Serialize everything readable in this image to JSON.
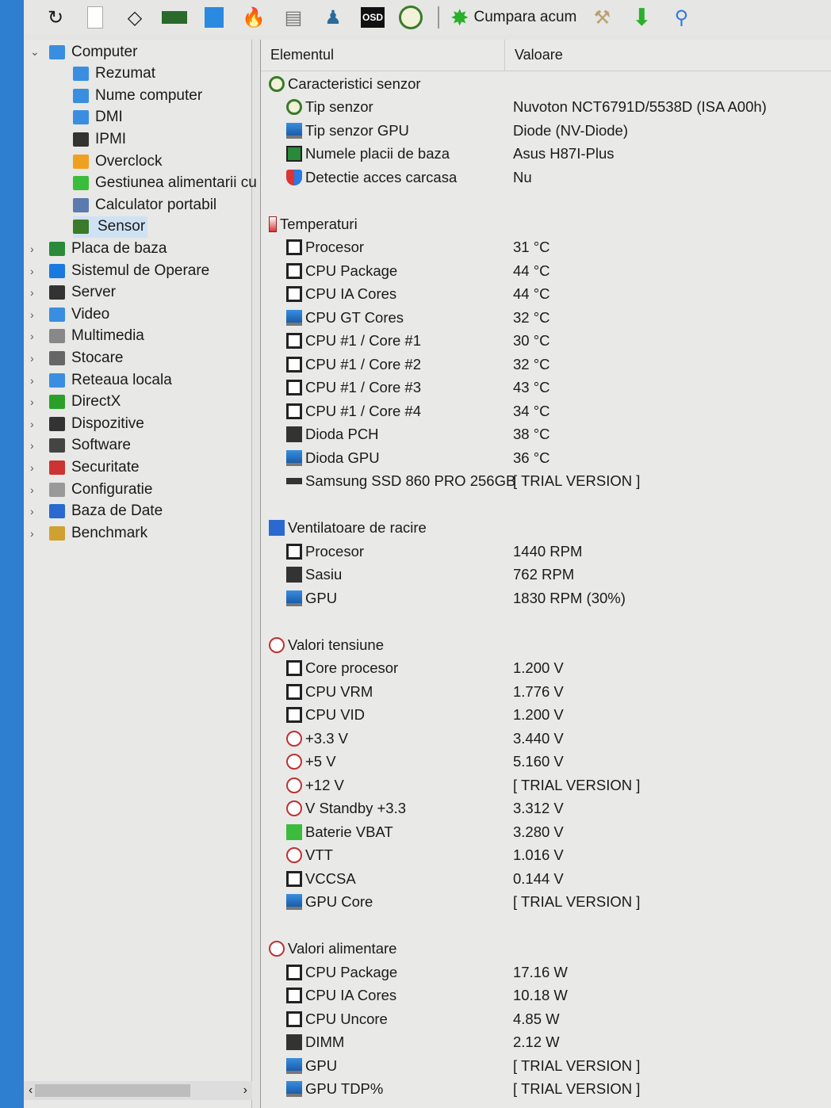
{
  "toolbar": {
    "icons": [
      "refresh-icon",
      "report-icon",
      "cpu-chip-icon",
      "memory-icon",
      "network-icon",
      "flame-icon",
      "benchmark-icon",
      "user-icon",
      "osd-icon",
      "sensor-gauge-icon"
    ],
    "osd_label": "OSD",
    "buy_label": "Cumpara acum",
    "right_icons": [
      "tools-icon",
      "download-icon",
      "search-icon"
    ]
  },
  "tree": {
    "items": [
      {
        "label": "Computer",
        "level": 0,
        "expanded": true,
        "icon": "computer-icon"
      },
      {
        "label": "Rezumat",
        "level": 1,
        "icon": "monitor-icon"
      },
      {
        "label": "Nume computer",
        "level": 1,
        "icon": "monitor-icon"
      },
      {
        "label": "DMI",
        "level": 1,
        "icon": "monitor-icon"
      },
      {
        "label": "IPMI",
        "level": 1,
        "icon": "server-icon"
      },
      {
        "label": "Overclock",
        "level": 1,
        "icon": "flame-icon"
      },
      {
        "label": "Gestiunea alimentarii cu",
        "level": 1,
        "icon": "battery-icon"
      },
      {
        "label": "Calculator portabil",
        "level": 1,
        "icon": "laptop-icon"
      },
      {
        "label": "Sensor",
        "level": 1,
        "icon": "gauge-icon",
        "selected": true
      },
      {
        "label": "Placa de baza",
        "level": 0,
        "icon": "motherboard-icon"
      },
      {
        "label": "Sistemul de Operare",
        "level": 0,
        "icon": "windows-icon"
      },
      {
        "label": "Server",
        "level": 0,
        "icon": "server-icon"
      },
      {
        "label": "Video",
        "level": 0,
        "icon": "monitor-icon"
      },
      {
        "label": "Multimedia",
        "level": 0,
        "icon": "speaker-icon"
      },
      {
        "label": "Stocare",
        "level": 0,
        "icon": "storage-icon"
      },
      {
        "label": "Reteaua locala",
        "level": 0,
        "icon": "network-icon"
      },
      {
        "label": "DirectX",
        "level": 0,
        "icon": "xbox-icon"
      },
      {
        "label": "Dispozitive",
        "level": 0,
        "icon": "device-icon"
      },
      {
        "label": "Software",
        "level": 0,
        "icon": "software-icon"
      },
      {
        "label": "Securitate",
        "level": 0,
        "icon": "shield-icon"
      },
      {
        "label": "Configuratie",
        "level": 0,
        "icon": "config-icon"
      },
      {
        "label": "Baza de Date",
        "level": 0,
        "icon": "database-icon"
      },
      {
        "label": "Benchmark",
        "level": 0,
        "icon": "benchmark-icon"
      }
    ]
  },
  "table": {
    "col_element": "Elementul",
    "col_value": "Valoare",
    "groups": [
      {
        "title": "Caracteristici senzor",
        "icon": "gauge",
        "rows": [
          {
            "name": "Tip senzor",
            "value": "Nuvoton NCT6791D/5538D  (ISA A00h)",
            "icon": "gauge"
          },
          {
            "name": "Tip senzor GPU",
            "value": "Diode  (NV-Diode)",
            "icon": "mon"
          },
          {
            "name": "Numele placii de baza",
            "value": "Asus H87I-Plus",
            "icon": "mb"
          },
          {
            "name": "Detectie acces carcasa",
            "value": "Nu",
            "icon": "shield"
          }
        ]
      },
      {
        "title": "Temperaturi",
        "icon": "therm",
        "rows": [
          {
            "name": "Procesor",
            "value": "31 °C",
            "icon": "sq"
          },
          {
            "name": "CPU Package",
            "value": "44 °C",
            "icon": "sq"
          },
          {
            "name": "CPU IA Cores",
            "value": "44 °C",
            "icon": "sq"
          },
          {
            "name": "CPU GT Cores",
            "value": "32 °C",
            "icon": "mon"
          },
          {
            "name": "CPU #1 / Core #1",
            "value": "30 °C",
            "icon": "sq"
          },
          {
            "name": "CPU #1 / Core #2",
            "value": "32 °C",
            "icon": "sq"
          },
          {
            "name": "CPU #1 / Core #3",
            "value": "43 °C",
            "icon": "sq"
          },
          {
            "name": "CPU #1 / Core #4",
            "value": "34 °C",
            "icon": "sq"
          },
          {
            "name": "Dioda PCH",
            "value": "38 °C",
            "icon": "chip"
          },
          {
            "name": "Dioda GPU",
            "value": "36 °C",
            "icon": "mon"
          },
          {
            "name": "Samsung SSD 860 PRO 256GB",
            "value": "[ TRIAL VERSION ]",
            "icon": "ssd"
          }
        ]
      },
      {
        "title": "Ventilatoare de racire",
        "icon": "fan",
        "rows": [
          {
            "name": "Procesor",
            "value": "1440 RPM",
            "icon": "sq"
          },
          {
            "name": "Sasiu",
            "value": "762 RPM",
            "icon": "chip"
          },
          {
            "name": "GPU",
            "value": "1830 RPM  (30%)",
            "icon": "mon"
          }
        ]
      },
      {
        "title": "Valori tensiune",
        "icon": "volt",
        "rows": [
          {
            "name": "Core procesor",
            "value": "1.200 V",
            "icon": "sq"
          },
          {
            "name": "CPU VRM",
            "value": "1.776 V",
            "icon": "sq"
          },
          {
            "name": "CPU VID",
            "value": "1.200 V",
            "icon": "sq"
          },
          {
            "name": "+3.3 V",
            "value": "3.440 V",
            "icon": "volt"
          },
          {
            "name": "+5 V",
            "value": "5.160 V",
            "icon": "volt"
          },
          {
            "name": "+12 V",
            "value": "[ TRIAL VERSION ]",
            "icon": "volt"
          },
          {
            "name": "V Standby +3.3",
            "value": "3.312 V",
            "icon": "volt"
          },
          {
            "name": "Baterie VBAT",
            "value": "3.280 V",
            "icon": "batt"
          },
          {
            "name": "VTT",
            "value": "1.016 V",
            "icon": "volt"
          },
          {
            "name": "VCCSA",
            "value": "0.144 V",
            "icon": "sq"
          },
          {
            "name": "GPU Core",
            "value": "[ TRIAL VERSION ]",
            "icon": "mon"
          }
        ]
      },
      {
        "title": "Valori alimentare",
        "icon": "volt",
        "rows": [
          {
            "name": "CPU Package",
            "value": "17.16 W",
            "icon": "sq"
          },
          {
            "name": "CPU IA Cores",
            "value": "10.18 W",
            "icon": "sq"
          },
          {
            "name": "CPU Uncore",
            "value": "4.85 W",
            "icon": "sq"
          },
          {
            "name": "DIMM",
            "value": "2.12 W",
            "icon": "chip"
          },
          {
            "name": "GPU",
            "value": "[ TRIAL VERSION ]",
            "icon": "mon"
          },
          {
            "name": "GPU TDP%",
            "value": "[ TRIAL VERSION ]",
            "icon": "mon"
          }
        ]
      }
    ]
  },
  "colors": {
    "selection": "#cfe2f3",
    "desktop": "#2f7fd0",
    "window": "#e6e6e4"
  }
}
